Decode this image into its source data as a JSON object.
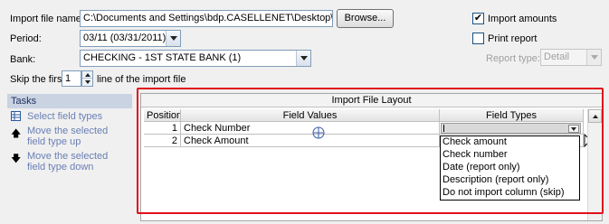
{
  "form": {
    "import_file_label": "Import file name:",
    "import_file_value": "C:\\Documents and Settings\\bdp.CASELLENET\\Desktop\\Cleared C",
    "browse_label": "Browse...",
    "period_label": "Period:",
    "period_value": "03/11 (03/31/2011)",
    "bank_label": "Bank:",
    "bank_value": "CHECKING - 1ST STATE BANK (1)",
    "skip_prefix": "Skip the first",
    "skip_value": "1",
    "skip_suffix": "line of the import file",
    "import_amounts_label": "Import amounts",
    "import_amounts_checked": true,
    "print_report_label": "Print report",
    "print_report_checked": false,
    "report_type_label": "Report type:",
    "report_type_value": "Detail"
  },
  "tasks": {
    "header": "Tasks",
    "items": [
      {
        "label": "Select field types",
        "icon": "table-icon"
      },
      {
        "label": "Move the selected field type up",
        "icon": "arrow-up-icon"
      },
      {
        "label": "Move the selected field type down",
        "icon": "arrow-down-icon"
      }
    ]
  },
  "layout": {
    "title": "Import File Layout",
    "columns": [
      "Position",
      "Field Values",
      "Field Types"
    ],
    "rows": [
      {
        "position": "1",
        "value": "Check Number",
        "type": ""
      },
      {
        "position": "2",
        "value": "Check Amount",
        "type": ""
      }
    ],
    "dropdown_options": [
      "Check amount",
      "Check number",
      "Date (report only)",
      "Description (report only)",
      "Do not import column (skip)"
    ]
  },
  "colors": {
    "highlight_border": "#e0101a",
    "task_link": "#6a7fb5",
    "tasks_header_bg": "#c9d3e2"
  }
}
